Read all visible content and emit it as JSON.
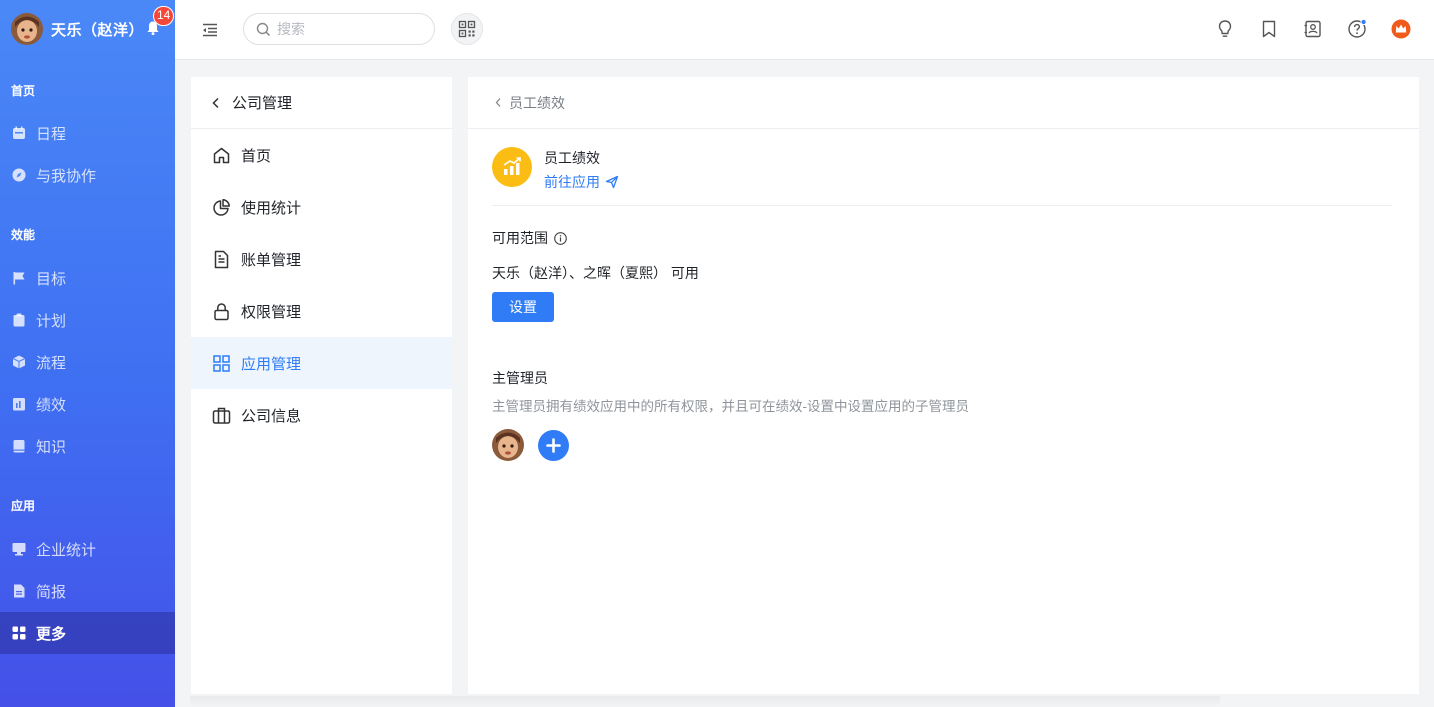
{
  "user": {
    "name": "天乐（赵洋）",
    "notification_count": "14"
  },
  "nav": {
    "sections": [
      {
        "label": "首页",
        "items": [
          {
            "label": "日程",
            "icon": "calendar-icon"
          },
          {
            "label": "与我协作",
            "icon": "compass-icon"
          }
        ]
      },
      {
        "label": "效能",
        "items": [
          {
            "label": "目标",
            "icon": "flag-icon"
          },
          {
            "label": "计划",
            "icon": "clipboard-icon"
          },
          {
            "label": "流程",
            "icon": "cube-icon"
          },
          {
            "label": "绩效",
            "icon": "chart-book-icon"
          },
          {
            "label": "知识",
            "icon": "book-icon"
          }
        ]
      },
      {
        "label": "应用",
        "items": [
          {
            "label": "企业统计",
            "icon": "monitor-icon"
          },
          {
            "label": "简报",
            "icon": "report-icon"
          },
          {
            "label": "更多",
            "icon": "grid-icon",
            "active": true
          }
        ]
      }
    ]
  },
  "topbar": {
    "search_placeholder": "搜索"
  },
  "submenu": {
    "title": "公司管理",
    "items": [
      {
        "label": "首页",
        "icon": "home-icon"
      },
      {
        "label": "使用统计",
        "icon": "pie-chart-icon"
      },
      {
        "label": "账单管理",
        "icon": "document-icon"
      },
      {
        "label": "权限管理",
        "icon": "lock-icon"
      },
      {
        "label": "应用管理",
        "icon": "apps-icon",
        "active": true
      },
      {
        "label": "公司信息",
        "icon": "briefcase-icon"
      }
    ]
  },
  "content": {
    "breadcrumb": "员工绩效",
    "app_name": "员工绩效",
    "app_link": "前往应用",
    "range_title": "可用范围",
    "range_text": "天乐（赵洋）、之晖（夏熙） 可用",
    "set_button": "设置",
    "admin_title": "主管理员",
    "admin_desc": "主管理员拥有绩效应用中的所有权限，并且可在绩效-设置中设置应用的子管理员"
  },
  "colors": {
    "accent": "#2f7cf6",
    "nav_top": "#4a88f7",
    "nav_bottom": "#4450e8",
    "app_logo": "#fbbd14",
    "badge": "#f5483b",
    "brand": "#f05a1a"
  }
}
